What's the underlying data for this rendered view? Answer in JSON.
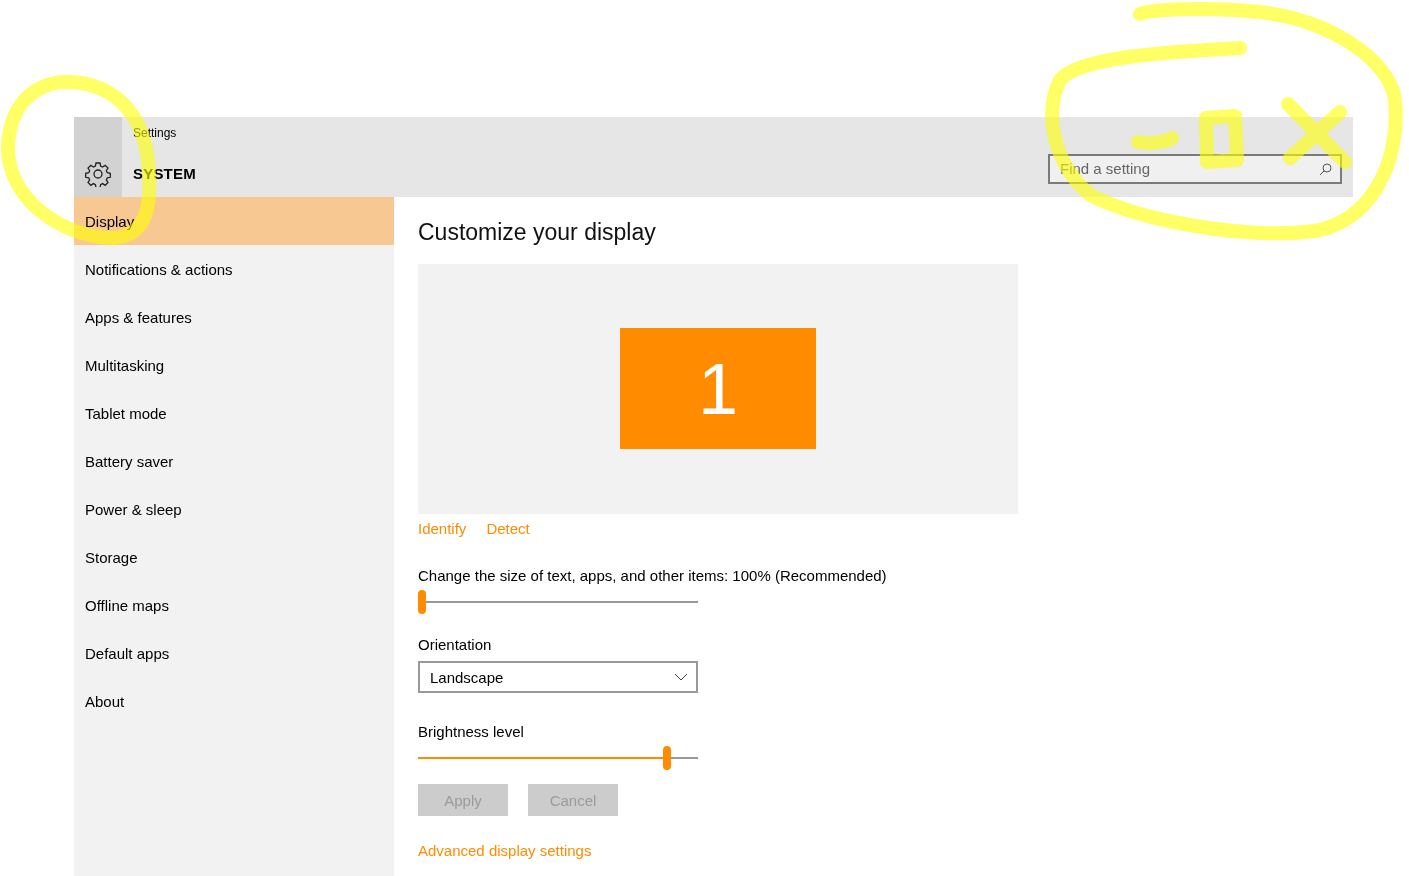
{
  "window": {
    "app_title": "Settings",
    "section_title": "SYSTEM"
  },
  "search": {
    "placeholder": "Find a setting"
  },
  "sidebar": {
    "items": [
      {
        "label": "Display",
        "selected": true
      },
      {
        "label": "Notifications & actions",
        "selected": false
      },
      {
        "label": "Apps & features",
        "selected": false
      },
      {
        "label": "Multitasking",
        "selected": false
      },
      {
        "label": "Tablet mode",
        "selected": false
      },
      {
        "label": "Battery saver",
        "selected": false
      },
      {
        "label": "Power & sleep",
        "selected": false
      },
      {
        "label": "Storage",
        "selected": false
      },
      {
        "label": "Offline maps",
        "selected": false
      },
      {
        "label": "Default apps",
        "selected": false
      },
      {
        "label": "About",
        "selected": false
      }
    ]
  },
  "content": {
    "heading": "Customize your display",
    "monitor": {
      "number": "1",
      "selected": true
    },
    "links": [
      "Identify",
      "Detect"
    ],
    "scale": {
      "label": "Change the size of text, apps, and other items: 100% (Recommended)",
      "level": 0
    },
    "orientation": {
      "label": "Orientation",
      "value": "Landscape"
    },
    "brightness": {
      "label": "Brightness level",
      "level": 0.89
    },
    "buttons": [
      {
        "label": "Apply",
        "disabled": true
      },
      {
        "label": "Cancel",
        "disabled": true
      }
    ],
    "advanced_link": "Advanced display settings"
  }
}
